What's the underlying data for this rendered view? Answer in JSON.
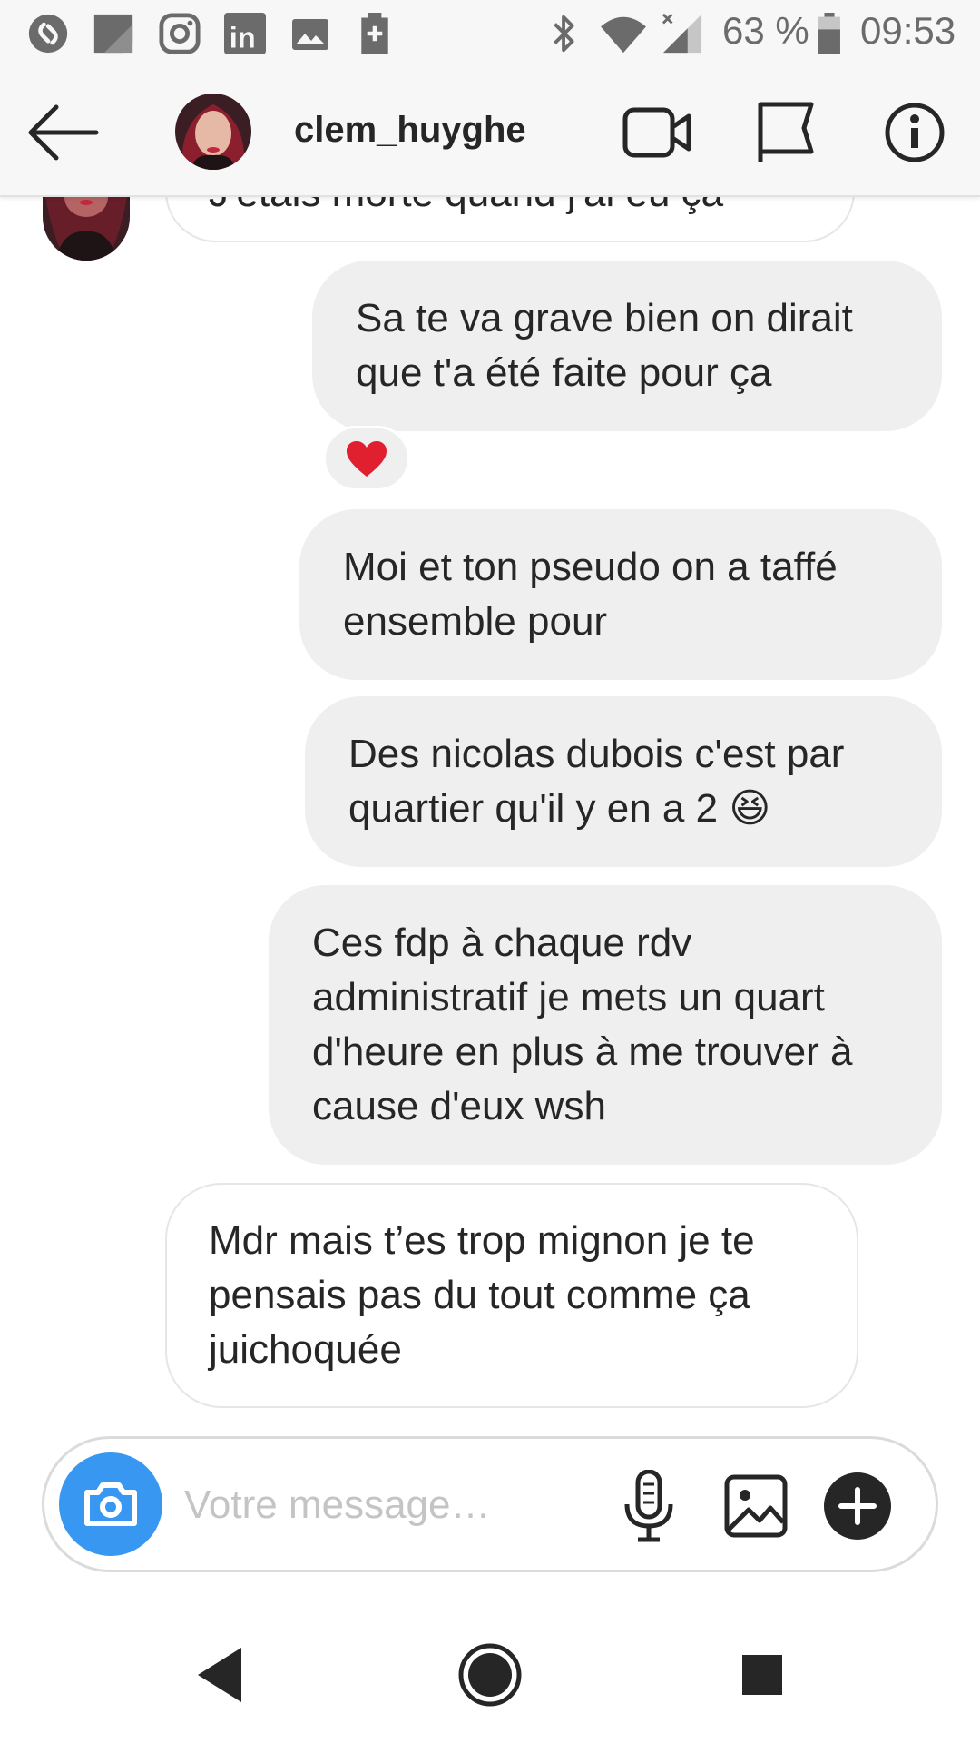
{
  "status_bar": {
    "battery_percent": "63 %",
    "time": "09:53",
    "left_icons": [
      "shazam-icon",
      "notes-icon",
      "instagram-icon",
      "linkedin-icon",
      "image-icon",
      "sim-icon"
    ],
    "right_icons": [
      "bluetooth-icon",
      "wifi-icon",
      "signal-icon",
      "battery-icon"
    ]
  },
  "header": {
    "username": "clem_huyghe",
    "buttons": [
      "video-call-icon",
      "flag-icon",
      "info-icon"
    ]
  },
  "messages": {
    "partial_top": "J'étais morte quand j'ai eu ça",
    "m1_line1": "Sa te va grave bien on dirait",
    "m1_line2": "que t'a été faite pour ça",
    "reaction": "❤️",
    "m2_line1": "Moi et ton pseudo on a taffé",
    "m2_line2": "ensemble pour",
    "m3_line1": "Des nicolas dubois c'est par",
    "m3_line2": "quartier qu'il y en a 2",
    "m3_emoji": "😆",
    "m4_line1": "Ces fdp à chaque rdv",
    "m4_line2": "administratif je mets un quart",
    "m4_line3": "d'heure en plus à me trouver à",
    "m4_line4": "cause d'eux wsh",
    "m5_line1": "Mdr mais t’es trop mignon je te",
    "m5_line2": "pensais pas du tout comme ça",
    "m5_line3": "juichoquée"
  },
  "composer": {
    "placeholder": "Votre message…",
    "value": ""
  },
  "colors": {
    "accent": "#3897f0",
    "bubble_out": "#efefef",
    "heart": "#e0202e"
  }
}
